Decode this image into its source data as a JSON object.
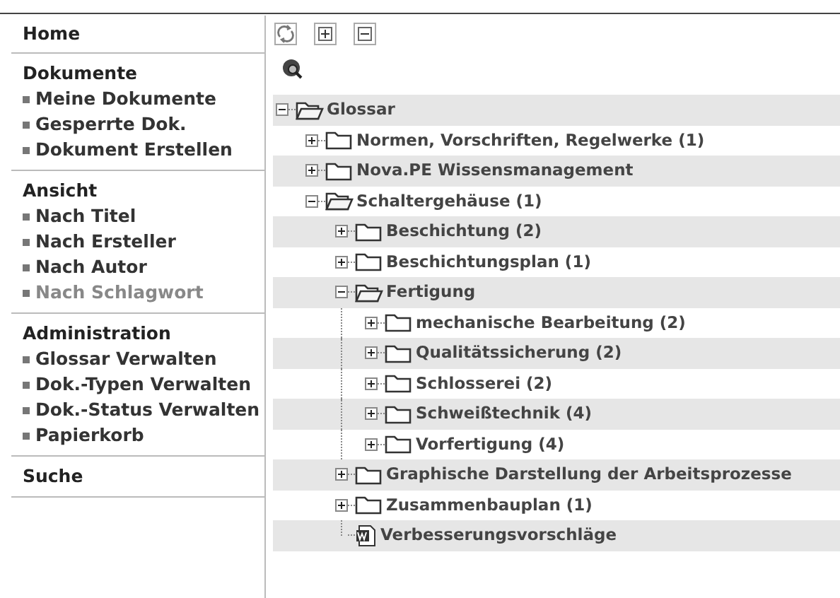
{
  "sidebar": [
    {
      "title": "Home"
    },
    {
      "title": "Dokumente",
      "items": [
        {
          "label": "Meine Dokumente",
          "disabled": false
        },
        {
          "label": "Gesperrte Dok.",
          "disabled": false
        },
        {
          "label": "Dokument Erstellen",
          "disabled": false
        }
      ]
    },
    {
      "title": "Ansicht",
      "items": [
        {
          "label": "Nach Titel",
          "disabled": false
        },
        {
          "label": "Nach Ersteller",
          "disabled": false
        },
        {
          "label": "Nach Autor",
          "disabled": false
        },
        {
          "label": "Nach Schlagwort",
          "disabled": true
        }
      ]
    },
    {
      "title": "Administration",
      "items": [
        {
          "label": "Glossar Verwalten",
          "disabled": false
        },
        {
          "label": "Dok.-Typen Verwalten",
          "disabled": false
        },
        {
          "label": "Dok.-Status Verwalten",
          "disabled": false
        },
        {
          "label": "Papierkorb",
          "disabled": false
        }
      ]
    },
    {
      "title": "Suche"
    }
  ],
  "tree": [
    {
      "kind": "folder",
      "label": "Glossar",
      "expanded": true,
      "children": [
        {
          "kind": "folder",
          "label": "Normen, Vorschriften, Regelwerke (1)",
          "expanded": false
        },
        {
          "kind": "folder",
          "label": "Nova.PE Wissensmanagement",
          "expanded": false
        },
        {
          "kind": "folder",
          "label": "Schaltergehäuse (1)",
          "expanded": true,
          "children": [
            {
              "kind": "folder",
              "label": "Beschichtung (2)",
              "expanded": false
            },
            {
              "kind": "folder",
              "label": "Beschichtungsplan (1)",
              "expanded": false
            },
            {
              "kind": "folder",
              "label": "Fertigung",
              "expanded": true,
              "children": [
                {
                  "kind": "folder",
                  "label": "mechanische Bearbeitung (2)",
                  "expanded": false
                },
                {
                  "kind": "folder",
                  "label": "Qualitätssicherung (2)",
                  "expanded": false
                },
                {
                  "kind": "folder",
                  "label": "Schlosserei (2)",
                  "expanded": false
                },
                {
                  "kind": "folder",
                  "label": "Schweißtechnik (4)",
                  "expanded": false
                },
                {
                  "kind": "folder",
                  "label": "Vorfertigung (4)",
                  "expanded": false
                }
              ]
            },
            {
              "kind": "folder",
              "label": "Graphische Darstellung der Arbeitsprozesse",
              "expanded": false
            },
            {
              "kind": "folder",
              "label": "Zusammenbauplan (1)",
              "expanded": false
            },
            {
              "kind": "document",
              "label": "Verbesserungsvorschläge"
            }
          ]
        }
      ]
    }
  ]
}
